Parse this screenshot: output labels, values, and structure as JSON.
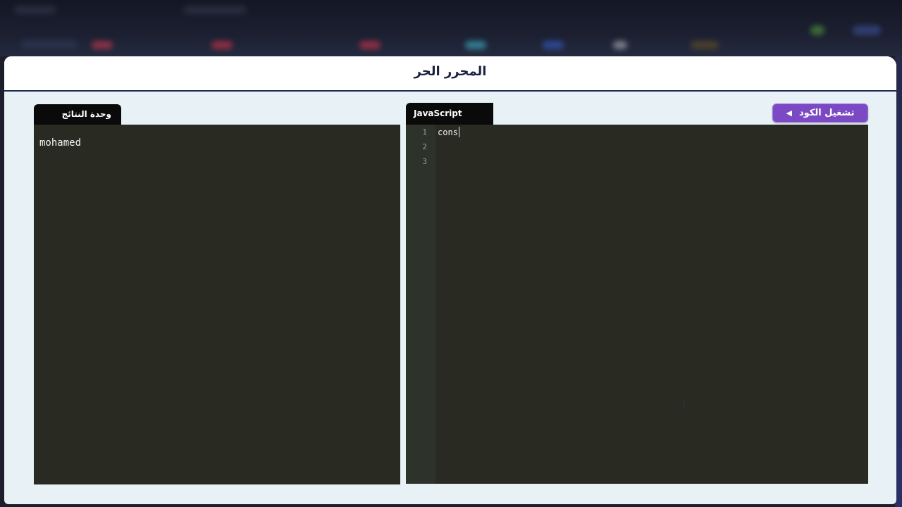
{
  "modal": {
    "title": "المحرر الحر"
  },
  "output": {
    "tab_label": "وحدة النتائج",
    "text": "mohamed"
  },
  "editor": {
    "tab_label": "JavaScript",
    "line_numbers": [
      "1",
      "2",
      "3"
    ],
    "lines": [
      "cons",
      "",
      ""
    ]
  },
  "toolbar": {
    "run_label": "تشغيل الكود",
    "run_icon": "◀"
  },
  "colors": {
    "accent": "#7b49c4",
    "panel_bg": "#292a22",
    "header_border": "#1f2a4f"
  }
}
